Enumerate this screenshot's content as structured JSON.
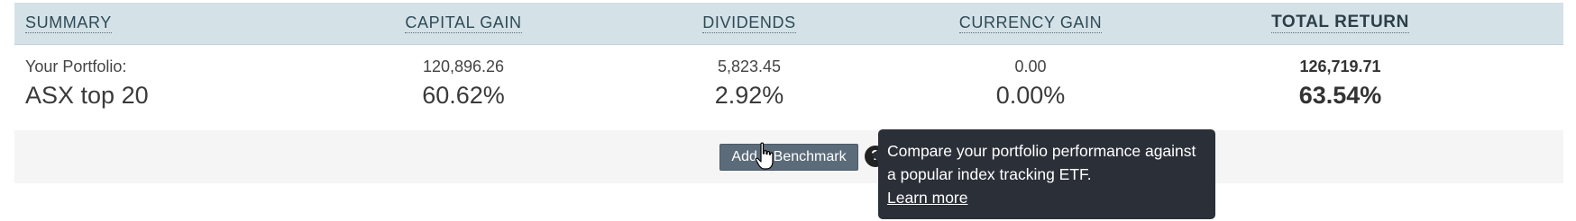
{
  "header": {
    "summary": "SUMMARY",
    "capital_gain": "CAPITAL GAIN",
    "dividends": "DIVIDENDS",
    "currency_gain": "CURRENCY GAIN",
    "total_return": "TOTAL RETURN"
  },
  "rows": {
    "portfolio": {
      "label": "Your Portfolio:",
      "capital_gain": "120,896.26",
      "dividends": "5,823.45",
      "currency_gain": "0.00",
      "total_return": "126,719.71"
    },
    "benchmark": {
      "label": "ASX top 20",
      "capital_gain": "60.62%",
      "dividends": "2.92%",
      "currency_gain": "0.00%",
      "total_return": "63.54%"
    }
  },
  "benchmark_bar": {
    "add_button_label": "Add a Benchmark",
    "help_icon": "?"
  },
  "tooltip": {
    "line1": "Compare your portfolio performance against",
    "line2": "a popular index tracking ETF.",
    "learn_more": "Learn more"
  },
  "colors": {
    "header_background": "#d4e2e7",
    "button_background": "#5c6b7a",
    "tooltip_background": "#2b2f38"
  }
}
